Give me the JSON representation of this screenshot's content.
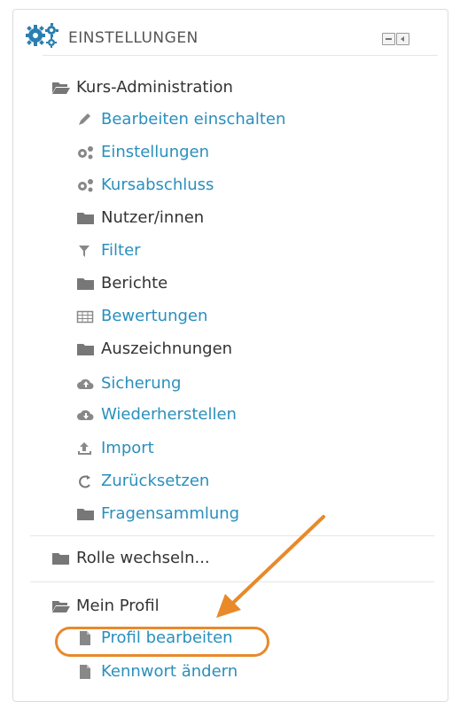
{
  "header": {
    "title": "EINSTELLUNGEN",
    "icon": "gears-icon"
  },
  "colors": {
    "link": "#2a8fbd",
    "text": "#333333",
    "highlight": "#e8892a"
  },
  "course_admin": {
    "label": "Kurs-Administration",
    "items": [
      {
        "label": "Bearbeiten einschalten",
        "icon": "pencil-icon"
      },
      {
        "label": "Einstellungen",
        "icon": "gears-icon"
      },
      {
        "label": "Kursabschluss",
        "icon": "gears-icon"
      },
      {
        "label": "Nutzer/innen",
        "icon": "folder-icon"
      },
      {
        "label": "Filter",
        "icon": "filter-icon"
      },
      {
        "label": "Berichte",
        "icon": "folder-icon"
      },
      {
        "label": "Bewertungen",
        "icon": "table-icon"
      },
      {
        "label": "Auszeichnungen",
        "icon": "folder-icon"
      },
      {
        "label": "Sicherung",
        "icon": "cloud-upload-icon"
      },
      {
        "label": "Wiederherstellen",
        "icon": "cloud-download-icon"
      },
      {
        "label": "Import",
        "icon": "upload-icon"
      },
      {
        "label": "Zurücksetzen",
        "icon": "reset-icon"
      },
      {
        "label": "Fragensammlung",
        "icon": "folder-icon"
      }
    ]
  },
  "switch_role": {
    "label": "Rolle wechseln..."
  },
  "my_profile": {
    "label": "Mein Profil",
    "items": [
      {
        "label": "Profil bearbeiten",
        "icon": "file-icon"
      },
      {
        "label": "Kennwort ändern",
        "icon": "file-icon"
      }
    ]
  }
}
